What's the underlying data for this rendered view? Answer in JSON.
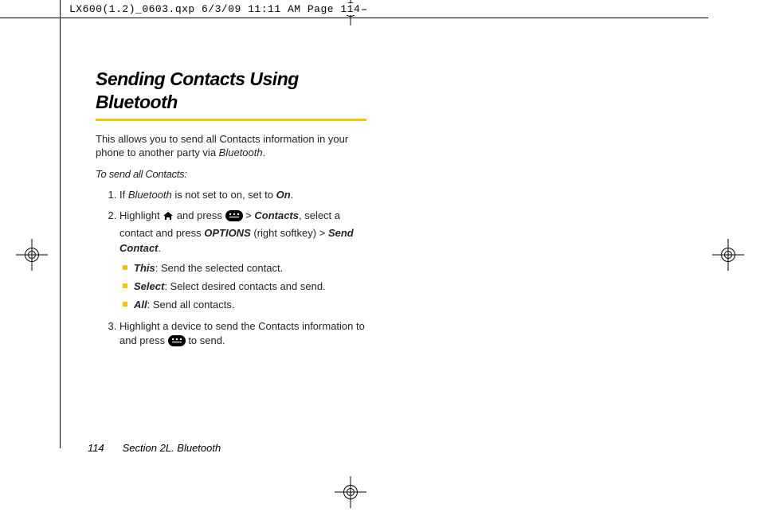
{
  "header_text": "LX600(1.2)_0603.qxp  6/3/09  11:11 AM  Page 114",
  "title": "Sending Contacts Using Bluetooth",
  "intro_prefix": "This allows you to send all Contacts information in your phone to another party via ",
  "intro_bt": "Bluetooth",
  "intro_suffix": ".",
  "subhead": "To send all Contacts:",
  "step1_prefix": "If ",
  "step1_bt": "Bluetooth",
  "step1_mid": " is not set to on, set to ",
  "step1_on": "On",
  "step1_suffix": ".",
  "step2_a": "Highlight ",
  "step2_b": " and press ",
  "step2_gt1": " > ",
  "step2_contacts": "Contacts",
  "step2_c": ", select a contact and press ",
  "step2_options": "OPTIONS",
  "step2_d": " (right softkey) ",
  "step2_gt2": "> ",
  "step2_send": "Send Contact",
  "step2_suffix": ".",
  "bullet_this_kw": "This",
  "bullet_this_txt": ": Send the selected contact.",
  "bullet_select_kw": "Select",
  "bullet_select_txt": ": Select desired contacts and send.",
  "bullet_all_kw": "All",
  "bullet_all_txt": ": Send all contacts.",
  "step3_a": "Highlight a device to send the Contacts information to and press ",
  "step3_b": " to send.",
  "footer_page": "114",
  "footer_section": "Section 2L. Bluetooth"
}
